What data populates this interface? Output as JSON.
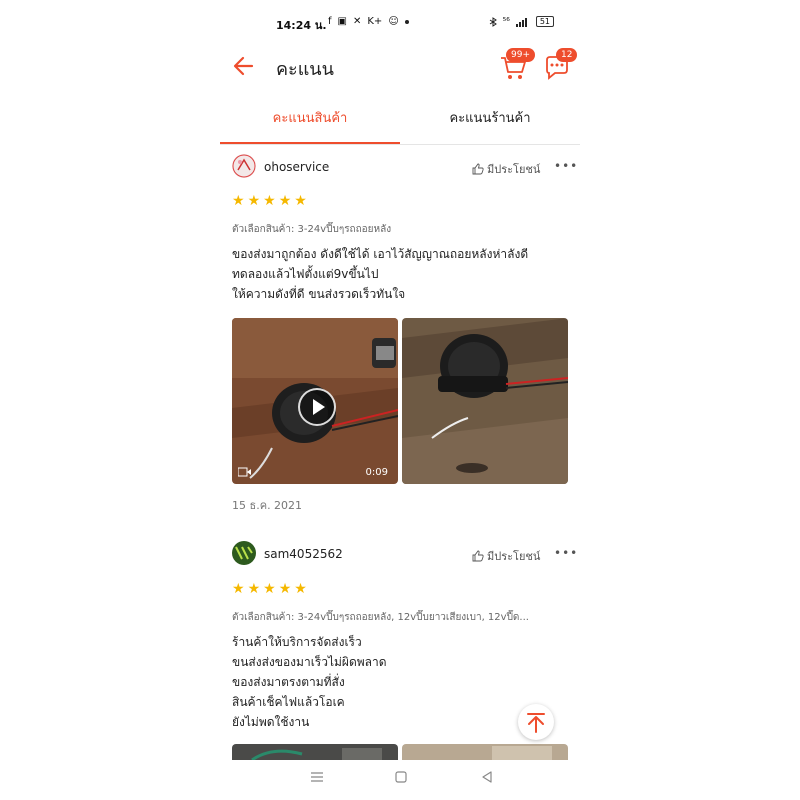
{
  "status": {
    "time": "14:24 น.",
    "left_icons": [
      "f",
      "▣",
      "✕",
      "K+",
      "☺"
    ],
    "net": "⁵⁶",
    "battery": "51"
  },
  "header": {
    "title": "คะแนน",
    "cart_badge": "99+",
    "chat_badge": "12"
  },
  "tabs": [
    {
      "label": "คะแนนสินค้า",
      "active": true
    },
    {
      "label": "คะแนนร้านค้า",
      "active": false
    }
  ],
  "reviews": [
    {
      "username": "ohoservice",
      "helpful_label": "มีประโยชน์",
      "more": "•••",
      "rating": 5,
      "variant": "ตัวเลือกสินค้า: 3-24vปี๊บๆรถถอยหลัง",
      "text": [
        "ของส่งมาถูกต้อง ดังดีใช้ได้ เอาไว้สัญญาณถอยหลังห่าลังดี",
        "ทดลองแล้วไฟตั้งแต่9vขึ้นไป",
        "ให้ความดังที่ดี ขนส่งรวดเร็วทันใจ"
      ],
      "video_duration": "0:09",
      "date": "15 ธ.ค. 2021"
    },
    {
      "username": "sam4052562",
      "helpful_label": "มีประโยชน์",
      "more": "•••",
      "rating": 5,
      "variant": "ตัวเลือกสินค้า: 3-24vปี๊บๆรถถอยหลัง, 12vปี๊บยาวเสียงเบา, 12vปี๊ด...",
      "text": [
        "ร้านค้าให้บริการจัดส่งเร็ว",
        "ขนส่งส่งของมาเร็วไม่ผิดพลาด",
        "ของส่งมาตรงตามที่สั่ง",
        "สินค้าเช็คไฟแล้วโอเค",
        "ยังไม่พดใช้งาน"
      ]
    }
  ],
  "colors": {
    "accent": "#ee4d2d",
    "star": "#f5b800"
  },
  "icons": {
    "back": "arrow-left-icon",
    "cart": "cart-icon",
    "chat": "chat-icon",
    "helpful": "thumbs-up-icon",
    "play": "play-icon",
    "video": "video-icon",
    "scroll_top": "arrow-up-icon"
  }
}
